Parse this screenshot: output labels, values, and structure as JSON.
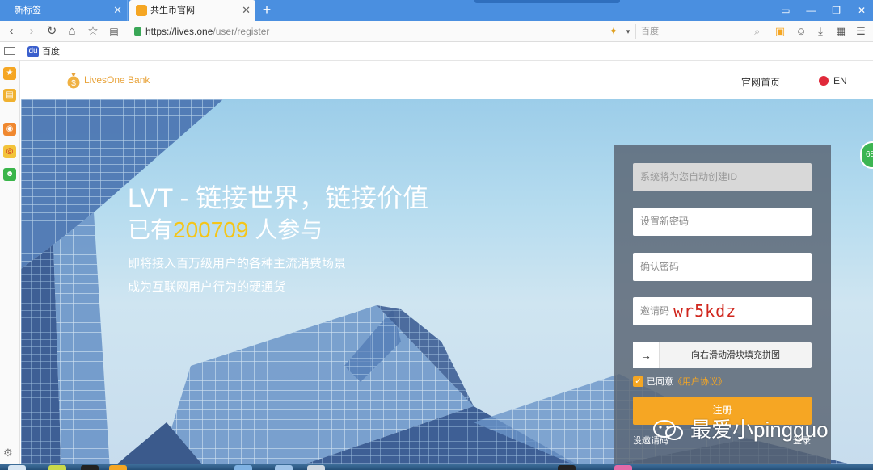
{
  "tabs": [
    {
      "label": "新标签",
      "active": false
    },
    {
      "label": "共生币官网",
      "active": true
    }
  ],
  "addressbar": {
    "url_host": "https://lives.one",
    "url_path": "/user/register",
    "search_placeholder": "百度"
  },
  "bookmarks": [
    {
      "label": "百度",
      "icon": "paw-icon"
    }
  ],
  "site": {
    "logo_text": "LivesOne Bank",
    "nav_home": "官网首页",
    "nav_lang": "EN"
  },
  "hero": {
    "headline1": "LVT - 链接世界，链接价值",
    "headline2_prefix": "已有",
    "participants": "200709",
    "headline2_suffix": " 人参与",
    "sub1": "即将接入百万级用户的各种主流消费场景",
    "sub2": "成为互联网用户行为的硬通货"
  },
  "register": {
    "id_placeholder": "系统将为您自动创建ID",
    "password_placeholder": "设置新密码",
    "confirm_placeholder": "确认密码",
    "invite_label": "邀请码",
    "invite_code": "wr5kdz",
    "slider_label": "向右滑动滑块填充拼图",
    "agree_prefix": "已同意",
    "agree_link": "《用户协议》",
    "agree_checked": true,
    "submit": "注册",
    "no_invite": "没邀请码",
    "login": "登录"
  },
  "watermark": "最爱小pingguo",
  "float_badge": "68",
  "colors": {
    "tabbar": "#4a8fe0",
    "accent": "#f6a623",
    "highlight_number": "#f5c518",
    "invite_code": "#d0261d"
  }
}
